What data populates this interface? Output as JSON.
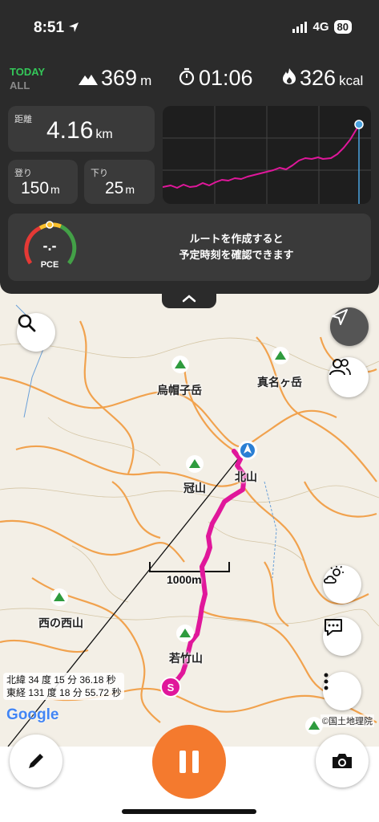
{
  "status": {
    "time": "8:51",
    "network": "4G",
    "battery": "80"
  },
  "summary": {
    "today_label": "TODAY",
    "all_label": "ALL",
    "elevation": "369",
    "elevation_unit": "m",
    "duration": "01:06",
    "calories": "326",
    "calories_unit": "kcal"
  },
  "distance": {
    "label": "距離",
    "value": "4.16",
    "unit": "km"
  },
  "ascent": {
    "label": "登り",
    "value": "150",
    "unit": "m"
  },
  "descent": {
    "label": "下り",
    "value": "25",
    "unit": "m"
  },
  "pce": {
    "value": "-.-",
    "label": "PCE",
    "message_line1": "ルートを作成すると",
    "message_line2": "予定時刻を確認できます"
  },
  "map": {
    "peaks": [
      "烏帽子岳",
      "真名ヶ岳",
      "冠山",
      "北山",
      "西の西山",
      "若竹山"
    ],
    "scale": "1000m",
    "coord_lat": "北緯 34 度 15 分 36.18 秒",
    "coord_lon": "東経 131 度 18 分 55.72 秒",
    "google": "Google",
    "credit": "©国土地理院",
    "start_marker": "S"
  },
  "colors": {
    "panel": "#2b2b2b",
    "route": "#e0179b",
    "accent": "#34c759",
    "record": "#f47a2e",
    "peak": "#2e9b3e"
  },
  "icons": [
    "mountain-icon",
    "stopwatch-icon",
    "flame-icon",
    "search-icon",
    "location-arrow-icon",
    "people-icon",
    "weather-icon",
    "chat-icon",
    "more-icon",
    "pencil-icon",
    "pause-icon",
    "camera-icon",
    "chevron-up-icon"
  ]
}
